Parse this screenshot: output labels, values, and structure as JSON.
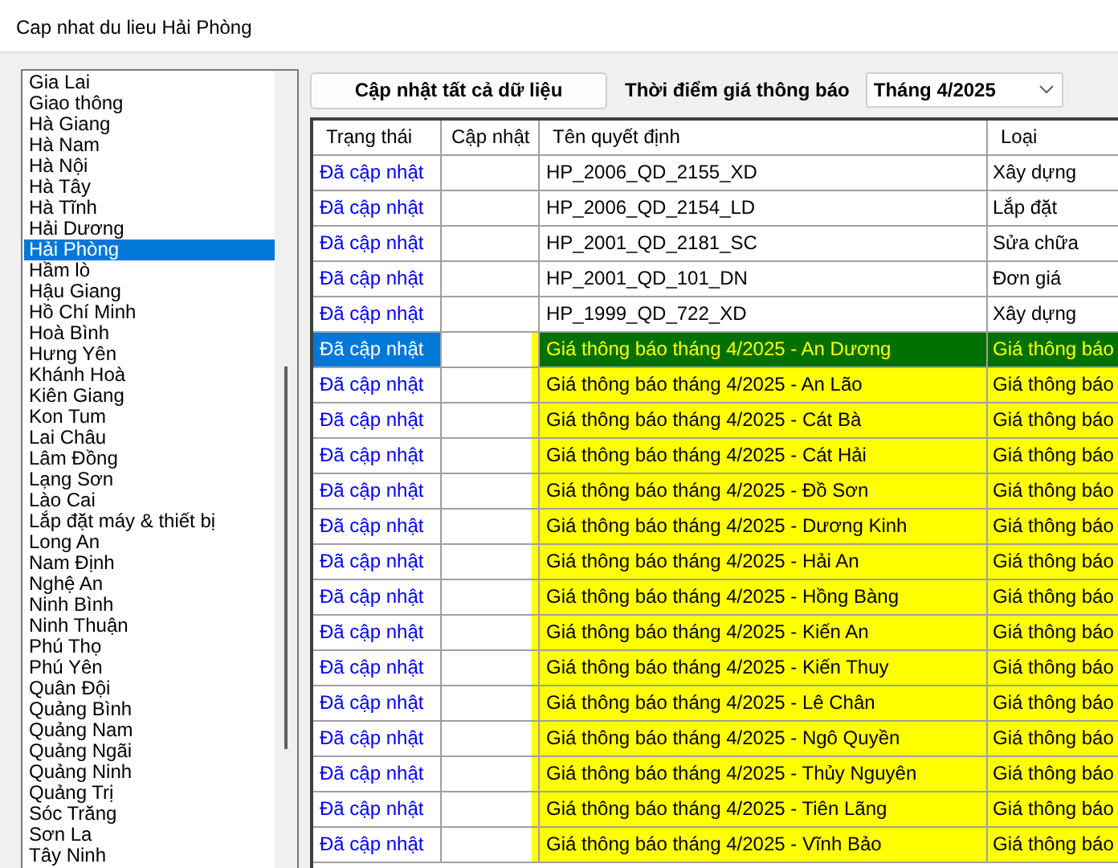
{
  "window": {
    "title": "Cap nhat du lieu Hải Phòng"
  },
  "provinces": [
    {
      "label": "Gia Lai",
      "selected": false
    },
    {
      "label": "Giao thông",
      "selected": false
    },
    {
      "label": "Hà Giang",
      "selected": false
    },
    {
      "label": "Hà Nam",
      "selected": false
    },
    {
      "label": "Hà Nội",
      "selected": false
    },
    {
      "label": "Hà Tây",
      "selected": false
    },
    {
      "label": "Hà Tĩnh",
      "selected": false
    },
    {
      "label": "Hải Dương",
      "selected": false
    },
    {
      "label": "Hải Phòng",
      "selected": true
    },
    {
      "label": "Hầm lò",
      "selected": false
    },
    {
      "label": "Hậu Giang",
      "selected": false
    },
    {
      "label": "Hồ Chí Minh",
      "selected": false
    },
    {
      "label": "Hoà Bình",
      "selected": false
    },
    {
      "label": "Hưng Yên",
      "selected": false
    },
    {
      "label": "Khánh Hoà",
      "selected": false
    },
    {
      "label": "Kiên Giang",
      "selected": false
    },
    {
      "label": "Kon Tum",
      "selected": false
    },
    {
      "label": "Lai Châu",
      "selected": false
    },
    {
      "label": "Lâm Đồng",
      "selected": false
    },
    {
      "label": "Lạng Sơn",
      "selected": false
    },
    {
      "label": "Lào Cai",
      "selected": false
    },
    {
      "label": "Lắp đặt máy & thiết bị",
      "selected": false
    },
    {
      "label": "Long An",
      "selected": false
    },
    {
      "label": "Nam Định",
      "selected": false
    },
    {
      "label": "Nghệ An",
      "selected": false
    },
    {
      "label": "Ninh Bình",
      "selected": false
    },
    {
      "label": "Ninh Thuận",
      "selected": false
    },
    {
      "label": "Phú Thọ",
      "selected": false
    },
    {
      "label": "Phú Yên",
      "selected": false
    },
    {
      "label": "Quân Đội",
      "selected": false
    },
    {
      "label": "Quảng Bình",
      "selected": false
    },
    {
      "label": "Quảng Nam",
      "selected": false
    },
    {
      "label": "Quảng Ngãi",
      "selected": false
    },
    {
      "label": "Quảng Ninh",
      "selected": false
    },
    {
      "label": "Quảng Trị",
      "selected": false
    },
    {
      "label": "Sóc Trăng",
      "selected": false
    },
    {
      "label": "Sơn La",
      "selected": false
    },
    {
      "label": "Tây Ninh",
      "selected": false
    }
  ],
  "toolbar": {
    "update_all_button": "Cập nhật tất cả dữ liệu",
    "period_label": "Thời điểm giá thông báo",
    "period_select": "Tháng 4/2025"
  },
  "table": {
    "columns": [
      "Trạng thái",
      "Cập nhật",
      "Tên quyết định",
      "Loại"
    ],
    "rows": [
      {
        "kind": "decision",
        "selected": false,
        "status": "Đã cập nhật",
        "name": "HP_2006_QD_2155_XD",
        "type": "Xây dựng"
      },
      {
        "kind": "decision",
        "selected": false,
        "status": "Đã cập nhật",
        "name": "HP_2006_QD_2154_LD",
        "type": "Lắp đặt"
      },
      {
        "kind": "decision",
        "selected": false,
        "status": "Đã cập nhật",
        "name": "HP_2001_QD_2181_SC",
        "type": "Sửa chữa"
      },
      {
        "kind": "decision",
        "selected": false,
        "status": "Đã cập nhật",
        "name": "HP_2001_QD_101_DN",
        "type": "Đơn giá"
      },
      {
        "kind": "decision",
        "selected": false,
        "status": "Đã cập nhật",
        "name": "HP_1999_QD_722_XD",
        "type": "Xây dựng"
      },
      {
        "kind": "price",
        "selected": true,
        "status": "Đã cập nhật",
        "name": "Giá thông báo tháng 4/2025 - An Dương",
        "type": "Giá thông báo"
      },
      {
        "kind": "price",
        "selected": false,
        "status": "Đã cập nhật",
        "name": "Giá thông báo tháng 4/2025 - An Lão",
        "type": "Giá thông báo"
      },
      {
        "kind": "price",
        "selected": false,
        "status": "Đã cập nhật",
        "name": "Giá thông báo tháng 4/2025 - Cát Bà",
        "type": "Giá thông báo"
      },
      {
        "kind": "price",
        "selected": false,
        "status": "Đã cập nhật",
        "name": "Giá thông báo tháng 4/2025 - Cát Hải",
        "type": "Giá thông báo"
      },
      {
        "kind": "price",
        "selected": false,
        "status": "Đã cập nhật",
        "name": "Giá thông báo tháng 4/2025 - Đồ Sơn",
        "type": "Giá thông báo"
      },
      {
        "kind": "price",
        "selected": false,
        "status": "Đã cập nhật",
        "name": "Giá thông báo tháng 4/2025 - Dương Kinh",
        "type": "Giá thông báo"
      },
      {
        "kind": "price",
        "selected": false,
        "status": "Đã cập nhật",
        "name": "Giá thông báo tháng 4/2025 - Hải An",
        "type": "Giá thông báo"
      },
      {
        "kind": "price",
        "selected": false,
        "status": "Đã cập nhật",
        "name": "Giá thông báo tháng 4/2025 - Hồng Bàng",
        "type": "Giá thông báo"
      },
      {
        "kind": "price",
        "selected": false,
        "status": "Đã cập nhật",
        "name": "Giá thông báo tháng 4/2025 - Kiến An",
        "type": "Giá thông báo"
      },
      {
        "kind": "price",
        "selected": false,
        "status": "Đã cập nhật",
        "name": "Giá thông báo tháng 4/2025 - Kiến Thuy",
        "type": "Giá thông báo"
      },
      {
        "kind": "price",
        "selected": false,
        "status": "Đã cập nhật",
        "name": "Giá thông báo tháng 4/2025 - Lê Chân",
        "type": "Giá thông báo"
      },
      {
        "kind": "price",
        "selected": false,
        "status": "Đã cập nhật",
        "name": "Giá thông báo tháng 4/2025 - Ngô Quyền",
        "type": "Giá thông báo"
      },
      {
        "kind": "price",
        "selected": false,
        "status": "Đã cập nhật",
        "name": "Giá thông báo tháng 4/2025 - Thủy Nguyên",
        "type": "Giá thông báo"
      },
      {
        "kind": "price",
        "selected": false,
        "status": "Đã cập nhật",
        "name": "Giá thông báo tháng 4/2025 - Tiên Lãng",
        "type": "Giá thông báo"
      },
      {
        "kind": "price",
        "selected": false,
        "status": "Đã cập nhật",
        "name": "Giá thông báo tháng 4/2025 - Vĩnh Bảo",
        "type": "Giá thông báo"
      }
    ]
  }
}
